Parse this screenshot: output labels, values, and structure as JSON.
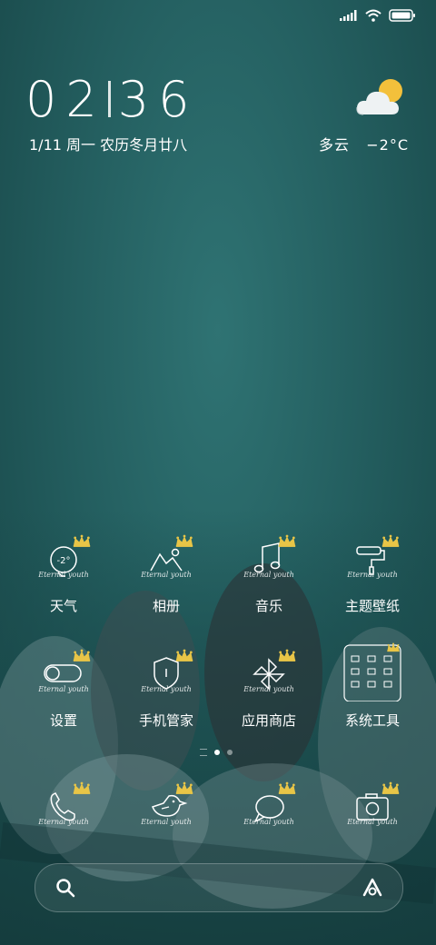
{
  "status_bar": {
    "signal": "signal-icon",
    "wifi": "wifi-icon",
    "battery": "battery-icon"
  },
  "clock": {
    "hours": "02",
    "minutes": "36"
  },
  "date_line": "1/11 周一 农历冬月廿八",
  "weather": {
    "condition": "多云",
    "temperature": "−2°C",
    "icon": "partly-cloudy-icon"
  },
  "app_script": "Eternal youth",
  "apps": [
    {
      "label": "天气",
      "icon": "weather-face-icon",
      "icon_text": "-2°"
    },
    {
      "label": "相册",
      "icon": "gallery-icon"
    },
    {
      "label": "音乐",
      "icon": "music-note-icon"
    },
    {
      "label": "主题壁纸",
      "icon": "paint-roller-icon"
    },
    {
      "label": "设置",
      "icon": "toggle-icon"
    },
    {
      "label": "手机管家",
      "icon": "shield-icon"
    },
    {
      "label": "应用商店",
      "icon": "pinwheel-icon"
    },
    {
      "label": "系统工具",
      "icon": "folder-grid-icon"
    }
  ],
  "dock": [
    {
      "icon": "phone-icon"
    },
    {
      "icon": "bird-icon"
    },
    {
      "icon": "chat-bubble-icon"
    },
    {
      "icon": "camera-icon"
    }
  ],
  "page_indicator": {
    "pages": 2,
    "active": 1
  },
  "search_bar": {
    "left_icon": "search-icon",
    "right_icon": "assistant-a-icon"
  },
  "colors": {
    "background": "#245f60",
    "crown": "#e8c547",
    "sun": "#f3c03b"
  }
}
